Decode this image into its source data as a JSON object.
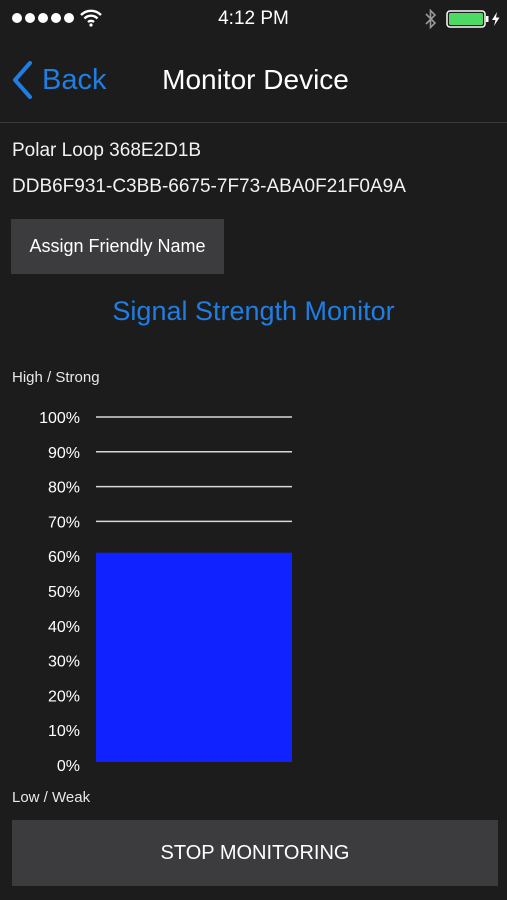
{
  "status_bar": {
    "time": "4:12 PM",
    "signal_icon": "signal-dots-icon",
    "wifi_icon": "wifi-icon",
    "bluetooth_icon": "bluetooth-icon",
    "battery_icon": "battery-charging-icon",
    "battery_color": "#4cd964"
  },
  "nav": {
    "back_label": "Back",
    "back_icon": "chevron-left-icon",
    "title": "Monitor Device"
  },
  "device": {
    "name": "Polar Loop 368E2D1B",
    "id": "DDB6F931-C3BB-6675-7F73-ABA0F21F0A9A"
  },
  "buttons": {
    "assign_label": "Assign Friendly Name",
    "stop_label": "STOP MONITORING"
  },
  "monitor": {
    "title": "Signal Strength Monitor",
    "high_label": "High / Strong",
    "low_label": "Low / Weak"
  },
  "colors": {
    "accent": "#1f7ee3",
    "bar": "#0f22ff",
    "background": "#1c1c1d",
    "button": "#3c3c3e"
  },
  "chart_data": {
    "type": "bar",
    "categories": [
      ""
    ],
    "values": [
      61
    ],
    "ylim": [
      0,
      100
    ],
    "yticks": [
      "0%",
      "10%",
      "20%",
      "30%",
      "40%",
      "50%",
      "60%",
      "70%",
      "80%",
      "90%",
      "100%"
    ],
    "grid": true,
    "title": "",
    "xlabel": "",
    "ylabel": ""
  }
}
